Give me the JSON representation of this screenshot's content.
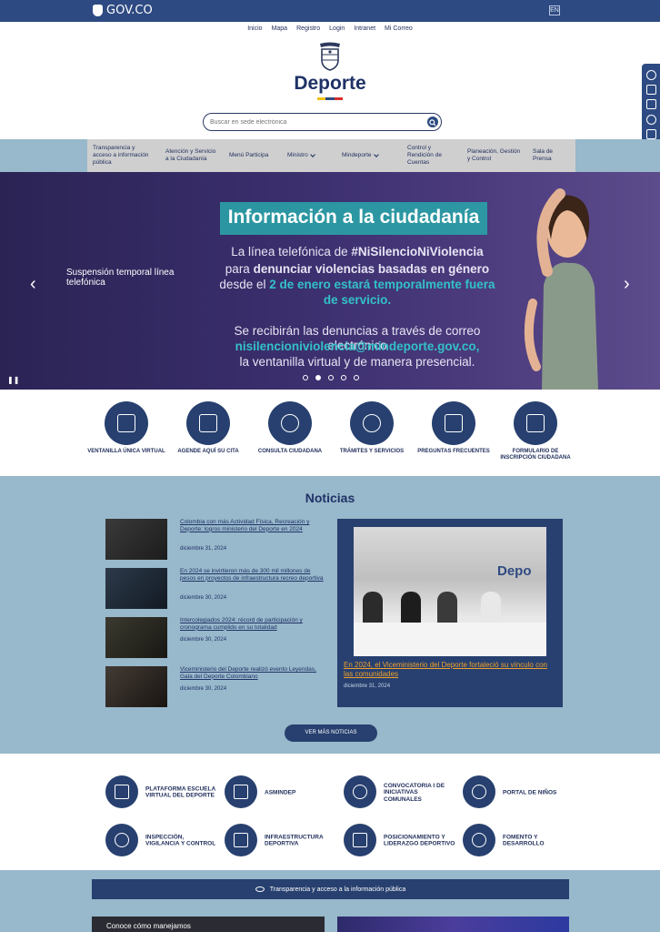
{
  "govbar": {
    "logo_text": "GOV.CO",
    "lang": "EN"
  },
  "top_links": [
    "Inicio",
    "Mapa",
    "Registro",
    "Login",
    "Intranet",
    "Mi Correo"
  ],
  "brand": {
    "title": "Deporte",
    "stripe_colors": [
      "#f1c21b",
      "#2e4a82",
      "#d62d2d"
    ]
  },
  "search": {
    "placeholder": "Buscar en sede electrónica"
  },
  "nav": [
    {
      "label": "Transparencia y acceso a información pública"
    },
    {
      "label": "Atención y Servicio a la Ciudadanía"
    },
    {
      "label": "Menú Participa"
    },
    {
      "label": "Ministro"
    },
    {
      "label": "Mindeporte"
    },
    {
      "label": "Control y Rendición de Cuentas"
    },
    {
      "label": "Planeación, Gestión y Control"
    },
    {
      "label": "Sala de Prensa"
    }
  ],
  "hero": {
    "side_text": "Suspensión temporal línea telefónica",
    "title": "Información a la ciudadanía",
    "line1_a": "La línea telefónica de ",
    "line1_b": "#NiSilencioNiViolencia",
    "line2_a": "para ",
    "line2_b": "denunciar violencias basadas en género",
    "line3_a": "desde el ",
    "line3_b": "2 de enero estará temporalmente fuera",
    "line4": "de servicio.",
    "line5": "Se recibirán las denuncias a través de correo electrónico",
    "line6": "nisilencioniviolencia@mindeporte.gov.co,",
    "line7": "la ventanilla virtual y de manera presencial.",
    "prev_arrow": "‹",
    "next_arrow": "›",
    "pause": "❚❚",
    "active_slide": 2,
    "slide_count": 5
  },
  "quick_access": [
    {
      "label": "VENTANILLA ÚNICA VIRTUAL",
      "icon": "window-icon"
    },
    {
      "label": "AGENDE AQUÍ SU CITA",
      "icon": "chat-icon"
    },
    {
      "label": "CONSULTA CIUDADANA",
      "icon": "headset-icon"
    },
    {
      "label": "TRÁMITES Y SERVICIOS",
      "icon": "badge-check-icon"
    },
    {
      "label": "PREGUNTAS FRECUENTES",
      "icon": "question-icon"
    },
    {
      "label": "FORMULARIO DE INSCRIPCIÓN CIUDADANA",
      "icon": "clipboard-icon"
    }
  ],
  "news": {
    "heading": "Noticias",
    "items": [
      {
        "title": "Colombia con más Actividad Física, Recreación y Deporte: logros ministerio del Deporte en 2024",
        "date": "diciembre 31, 2024"
      },
      {
        "title": "En 2024 se invirtieron más de 300 mil millones de pesos en proyectos de infraestructura recreo deportiva",
        "date": "diciembre 30, 2024"
      },
      {
        "title": "Intercolegiados 2024: récord de participación y cronograma cumplido en su totalidad",
        "date": "diciembre 30, 2024"
      },
      {
        "title": "Viceministerio del Deporte realizó evento Leyendas, Gala del Deporte Colombiano",
        "date": "diciembre 30, 2024"
      }
    ],
    "featured": {
      "title": "En 2024, el Viceministerio del Deporte fortaleció su vínculo con las comunidades",
      "date": "diciembre 31, 2024",
      "photo_logo": "Depo"
    },
    "more_button": "VER MÁS NOTICIAS"
  },
  "services": [
    {
      "label": "PLATAFORMA ESCUELA VIRTUAL DEL DEPORTE",
      "icon": "presentation-icon"
    },
    {
      "label": "ASMINDEP",
      "icon": "certificate-icon"
    },
    {
      "label": "CONVOCATORIA I DE INICIATIVAS COMUNALES",
      "icon": "people-icon"
    },
    {
      "label": "PORTAL DE NIÑOS",
      "icon": "kid-face-icon"
    },
    {
      "label": "INSPECCIÓN, VIGILANCIA Y CONTROL",
      "icon": "magnifier-icon"
    },
    {
      "label": "INFRAESTRUCTURA DEPORTIVA",
      "icon": "building-icon"
    },
    {
      "label": "POSICIONAMIENTO Y LIDERAZGO DEPORTIVO",
      "icon": "flag-icon"
    },
    {
      "label": "FOMENTO Y DESARROLLO",
      "icon": "growth-icon"
    }
  ],
  "transparency": {
    "label": "Transparencia y acceso a la información pública"
  },
  "bottom_card": {
    "text": "Conoce cómo manejamos"
  }
}
